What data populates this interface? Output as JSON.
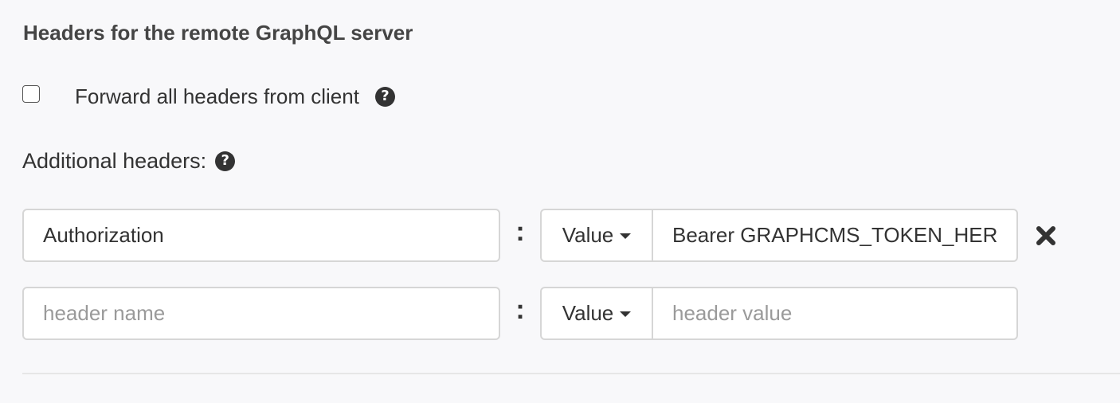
{
  "section": {
    "title": "Headers for the remote GraphQL server"
  },
  "forward": {
    "label": "Forward all headers from client",
    "checked": false,
    "help_icon": "question-circle-icon"
  },
  "additional": {
    "label": "Additional headers:",
    "help_icon": "question-circle-icon"
  },
  "headers": [
    {
      "name_value": "Authorization",
      "name_placeholder": "header name",
      "separator": ":",
      "type_label": "Value",
      "value": "Bearer GRAPHCMS_TOKEN_HERE",
      "value_placeholder": "header value",
      "remove_icon": "close-x-icon"
    },
    {
      "name_value": "",
      "name_placeholder": "header name",
      "separator": ":",
      "type_label": "Value",
      "value": "",
      "value_placeholder": "header value"
    }
  ],
  "colors": {
    "background": "#f8f8fa",
    "text": "#333333",
    "border": "#d6d6d6",
    "placeholder": "#9a9a9a"
  }
}
